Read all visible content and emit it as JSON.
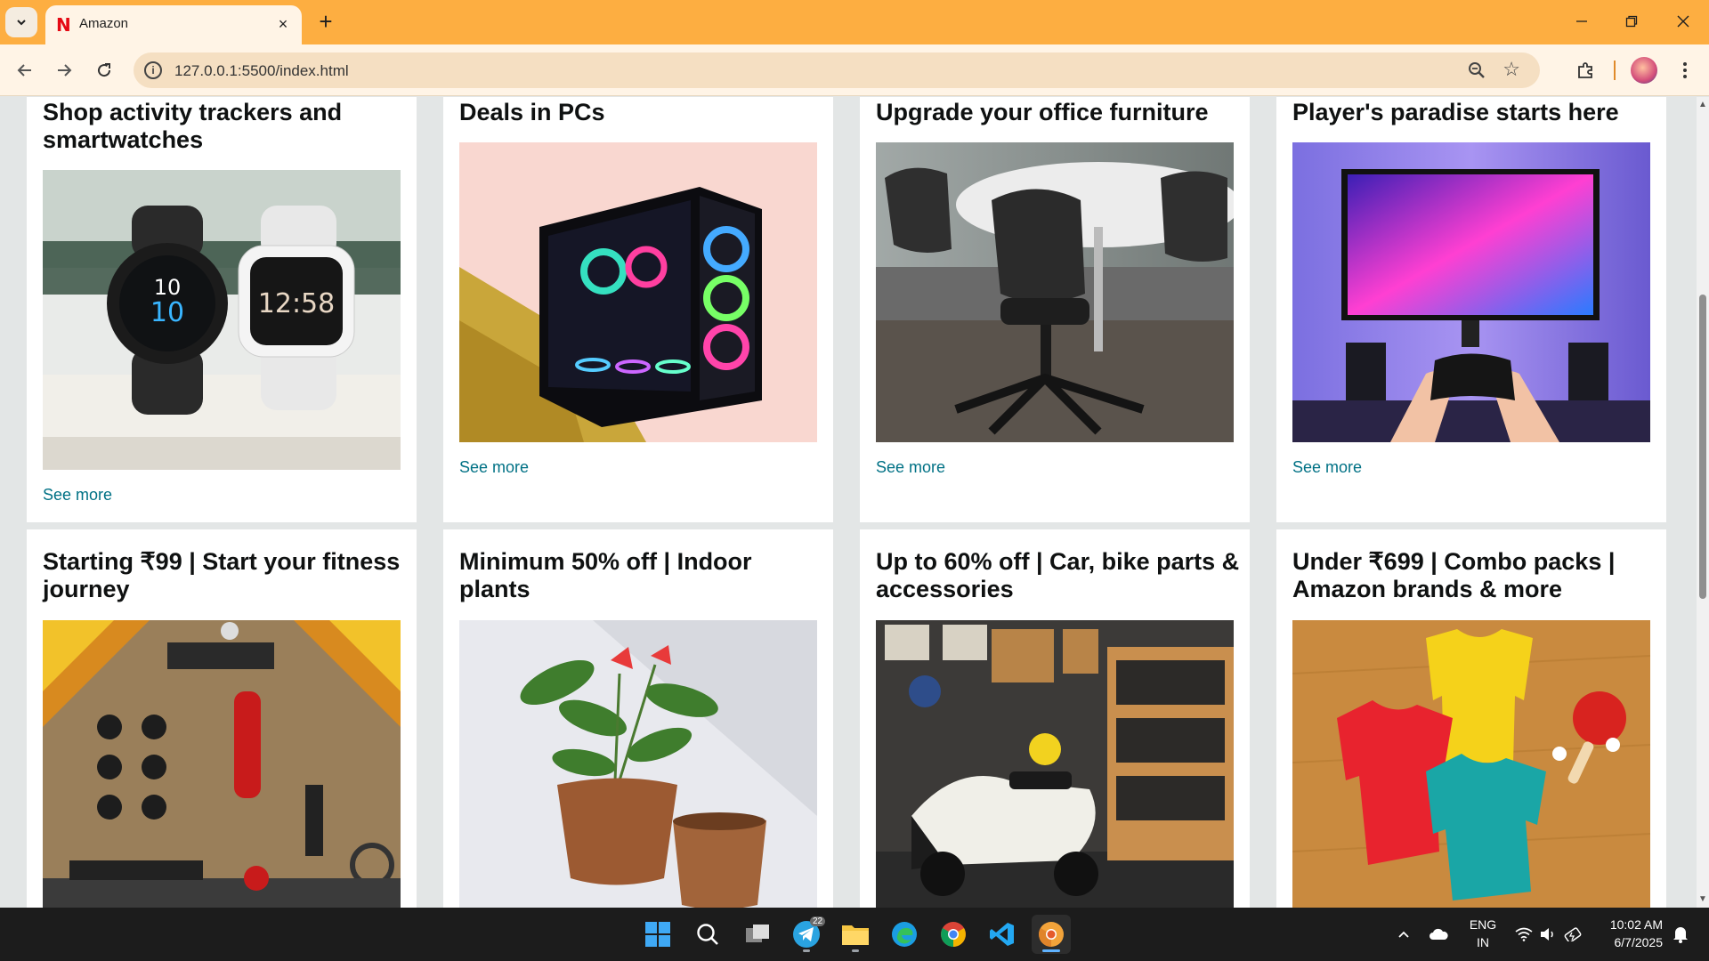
{
  "browser": {
    "tab_title": "Amazon",
    "url": "127.0.0.1:5500/index.html",
    "new_tab": "+",
    "close_tab": "×"
  },
  "cards": [
    {
      "title": "Shop activity trackers and smartwatches",
      "link": "See more",
      "image": "smartwatches-photo"
    },
    {
      "title": "Deals in PCs",
      "link": "See more",
      "image": "gaming-pc-photo"
    },
    {
      "title": "Upgrade your office furniture",
      "link": "See more",
      "image": "office-chair-photo"
    },
    {
      "title": "Player's paradise starts here",
      "link": "See more",
      "image": "gaming-controller-photo"
    },
    {
      "title": "Starting ₹99 | Start your fitness journey",
      "image": "home-gym-photo"
    },
    {
      "title": "Minimum 50% off | Indoor plants",
      "image": "indoor-plant-photo"
    },
    {
      "title": "Up to 60% off | Car, bike parts & accessories",
      "image": "scooter-garage-photo"
    },
    {
      "title": "Under ₹699 | Combo packs | Amazon brands & more",
      "image": "tshirts-combo-photo"
    }
  ],
  "taskbar": {
    "telegram_badge": "22",
    "language": "ENG",
    "region": "IN",
    "time": "10:02 AM",
    "date": "6/7/2025"
  },
  "colors": {
    "tabstrip": "#fdae41",
    "link": "#007185",
    "page_bg": "#e3e6e6"
  }
}
